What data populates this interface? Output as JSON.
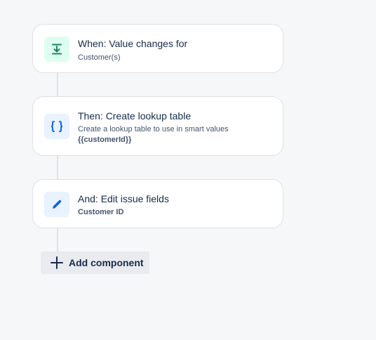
{
  "steps": [
    {
      "title": "When: Value changes for",
      "subtitle": "Customer(s)",
      "icon": "download-arrow-icon",
      "kind": "trigger"
    },
    {
      "title": "Then: Create lookup table",
      "subtitle": "Create a lookup table to use in smart values",
      "detail": "{{customerId}}",
      "icon": "curly-braces-icon",
      "kind": "action"
    },
    {
      "title": "And: Edit issue fields",
      "subtitle": "Customer ID",
      "icon": "pencil-icon",
      "kind": "action"
    }
  ],
  "add_component": {
    "label": "Add component",
    "icon": "plus-icon"
  },
  "colors": {
    "background": "#f6f7f9",
    "trigger_icon_bg": "#dcfff1",
    "trigger_icon_fg": "#1f845a",
    "action_icon_bg": "#e9f2ff",
    "action_icon_fg": "#0c66e4",
    "text": "#172b4d",
    "subtext": "#44546f",
    "border": "#dfe1e6"
  }
}
